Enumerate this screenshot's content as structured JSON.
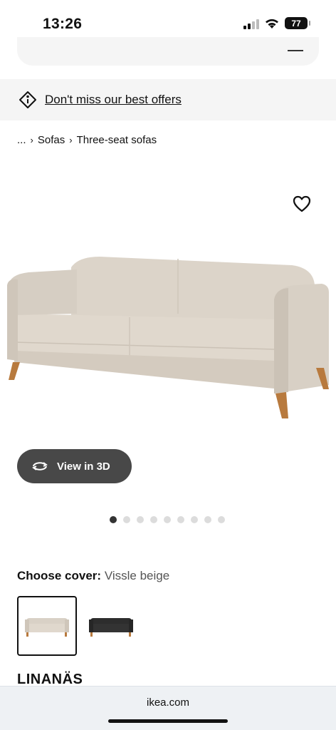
{
  "status": {
    "time": "13:26",
    "battery": "77"
  },
  "offer": {
    "text": "Don't miss our best offers"
  },
  "breadcrumb": {
    "ellipsis": "...",
    "items": [
      "Sofas",
      "Three-seat sofas"
    ]
  },
  "view3d": {
    "label": "View in 3D"
  },
  "carousel": {
    "count": 9,
    "active": 1
  },
  "cover": {
    "label": "Choose cover:",
    "value": "Vissle beige",
    "options": [
      "Vissle beige",
      "dark grey"
    ]
  },
  "product": {
    "name": "LINANÄS"
  },
  "browser": {
    "url": "ikea.com"
  },
  "colors": {
    "beige": "#d9d1c6",
    "wood": "#b87a3e",
    "dark": "#2d2d2d"
  }
}
